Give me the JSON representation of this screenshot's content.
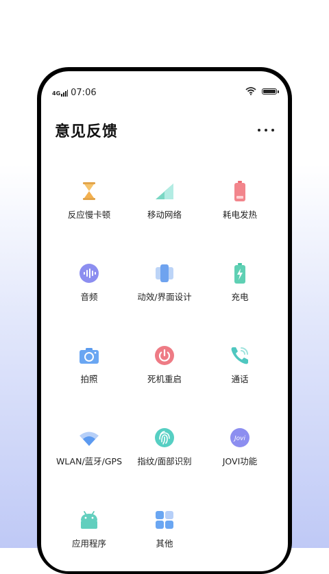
{
  "status_bar": {
    "network": "4G",
    "time": "07:06"
  },
  "header": {
    "title": "意见反馈"
  },
  "items": [
    {
      "label": "反应慢卡顿",
      "icon": "hourglass-icon"
    },
    {
      "label": "移动网络",
      "icon": "cellular-signal-icon"
    },
    {
      "label": "耗电发热",
      "icon": "battery-heat-icon"
    },
    {
      "label": "音频",
      "icon": "audio-wave-icon"
    },
    {
      "label": "动效/界面设计",
      "icon": "interface-design-icon"
    },
    {
      "label": "充电",
      "icon": "charging-icon"
    },
    {
      "label": "拍照",
      "icon": "camera-icon"
    },
    {
      "label": "死机重启",
      "icon": "power-icon"
    },
    {
      "label": "通话",
      "icon": "phone-call-icon"
    },
    {
      "label": "WLAN/蓝牙/GPS",
      "icon": "wifi-icon"
    },
    {
      "label": "指纹/面部识别",
      "icon": "fingerprint-icon"
    },
    {
      "label": "JOVI功能",
      "icon": "jovi-icon"
    },
    {
      "label": "应用程序",
      "icon": "android-app-icon"
    },
    {
      "label": "其他",
      "icon": "grid-other-icon"
    }
  ],
  "jovi_badge": "Jovi"
}
